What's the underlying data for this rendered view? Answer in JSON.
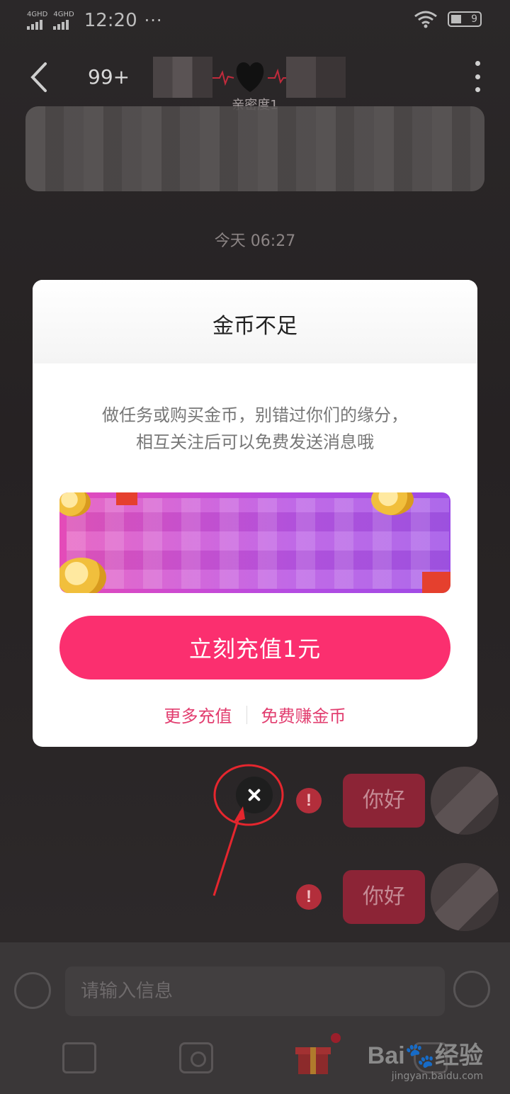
{
  "status_bar": {
    "network1": "4GHD",
    "network2": "4GHD",
    "time": "12:20",
    "dots": "···",
    "battery_level": "9"
  },
  "header": {
    "unread_count": "99+",
    "intimacy_label": "亲密度1"
  },
  "chat": {
    "timestamp": "今天 06:27",
    "messages": [
      {
        "text": "你好",
        "status": "failed"
      },
      {
        "text": "你好",
        "status": "failed"
      }
    ],
    "bubble_color": "#8c2436"
  },
  "modal": {
    "title": "金币不足",
    "description_line1": "做任务或购买金币，别错过你们的缘分，",
    "description_line2": "相互关注后可以免费发送消息哦",
    "recharge_button": "立刻充值1元",
    "more_recharge_link": "更多充值",
    "earn_coins_link": "免费赚金币",
    "accent_color": "#fb2f6f"
  },
  "input": {
    "placeholder": "请输入信息"
  },
  "toolbar": {
    "items": [
      "image-icon",
      "camera-icon",
      "gift-icon",
      "call-icon"
    ]
  },
  "watermark": {
    "logo": "Bai🐾经验",
    "url": "jingyan.baidu.com"
  }
}
